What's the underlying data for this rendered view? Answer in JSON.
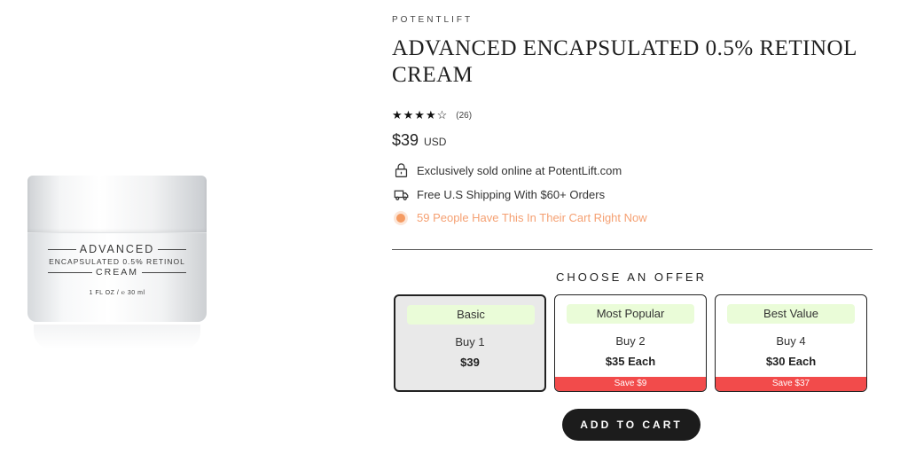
{
  "product": {
    "brand": "POTENTLIFT",
    "title": "ADVANCED ENCAPSULATED 0.5% RETINOL CREAM",
    "rating_stars": "★★★★☆",
    "rating_value": 4.5,
    "review_count": "(26)",
    "price": "$39",
    "currency": "USD",
    "image_label": {
      "line1": "ADVANCED",
      "line2": "ENCAPSULATED 0.5% RETINOL",
      "line3": "CREAM",
      "line4": "1 FL OZ / ℮ 30 ml"
    }
  },
  "features": [
    {
      "icon": "lock-icon",
      "text": "Exclusively sold online at PotentLift.com"
    },
    {
      "icon": "truck-icon",
      "text": "Free U.S Shipping With $60+ Orders"
    },
    {
      "icon": "pulse-dot-icon",
      "text": "59 People Have This In Their Cart Right Now",
      "color": "#f5a072"
    }
  ],
  "offers": {
    "heading": "CHOOSE AN OFFER",
    "items": [
      {
        "tag": "Basic",
        "qty": "Buy 1",
        "price": "$39",
        "save": "",
        "selected": true
      },
      {
        "tag": "Most Popular",
        "qty": "Buy 2",
        "price": "$35 Each",
        "save": "Save $9",
        "selected": false
      },
      {
        "tag": "Best Value",
        "qty": "Buy 4",
        "price": "$30 Each",
        "save": "Save $37",
        "selected": false
      }
    ]
  },
  "cta": {
    "label": "ADD TO CART"
  },
  "colors": {
    "tag_bg": "#eafcd8",
    "save_bg": "#f24b4b",
    "urgency_text": "#f5a072",
    "button_bg": "#1c1c1c"
  }
}
